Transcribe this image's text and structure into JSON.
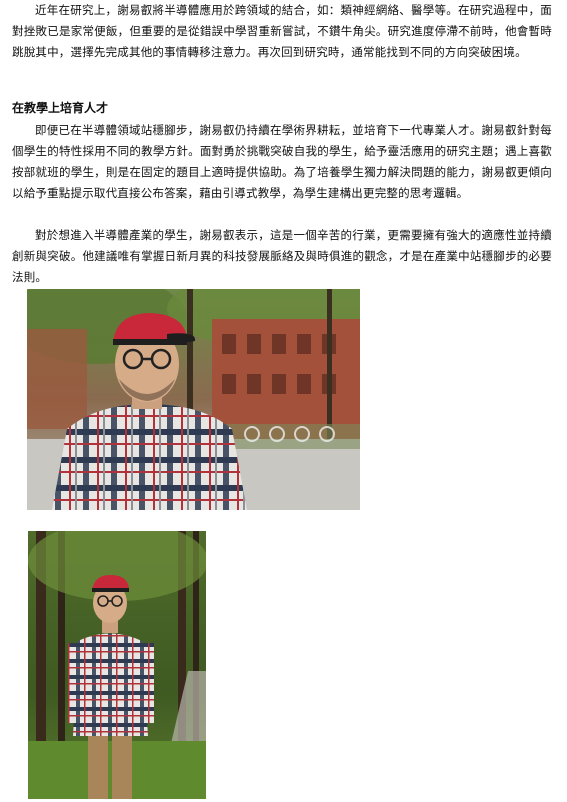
{
  "article": {
    "para1": "近年在研究上，謝易叡將半導體應用於跨領域的結合，如：類神經網絡、醫學等。在研究過程中，面對挫敗已是家常便飯，但重要的是從錯誤中學習重新嘗試，不鑽牛角尖。研究進度停滯不前時，他會暫時跳脫其中，選擇先完成其他的事情轉移注意力。再次回到研究時，通常能找到不同的方向突破困境。",
    "section_heading": "在教學上培育人才",
    "para2": "即便已在半導體領域站穩腳步，謝易叡仍持續在學術界耕耘，並培育下一代專業人才。謝易叡針對每個學生的特性採用不同的教學方針。面對勇於挑戰突破自我的學生，給予靈活應用的研究主題；遇上喜歡按部就班的學生，則是在固定的題目上適時提供協助。為了培養學生獨力解決問題的能力，謝易叡更傾向以給予重點提示取代直接公布答案，藉由引導式教學，為學生建構出更完整的思考邏輯。",
    "para3": "對於想進入半導體產業的學生，謝易叡表示，這是一個辛苦的行業，更需要擁有強大的適應性並持續創新與突破。他建議唯有掌握日新月異的科技發展脈絡及與時俱進的觀念，才是在產業中站穩腳步的必要法則。"
  },
  "colors": {
    "cap_red": "#c8283a",
    "foliage": "#4f6b2c",
    "brick": "#a4513c",
    "plaid_red": "#b0323a",
    "plaid_navy": "#2d3a52"
  }
}
